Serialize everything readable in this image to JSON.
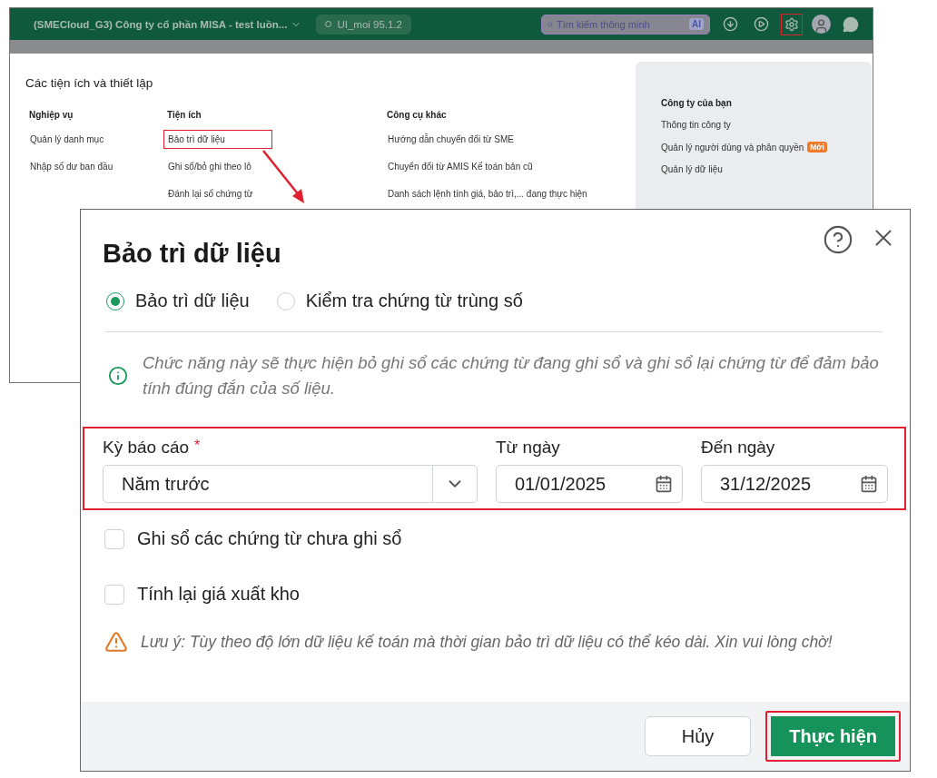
{
  "app_bar": {
    "company": "(SMECloud_G3) Công ty cổ phần MISA - test luồn...",
    "version": "UI_moi 95.1.2",
    "search": {
      "placeholder": "Tìm kiếm thông minh",
      "badge": "AI"
    },
    "settings_highlighted": true
  },
  "settings_menu": {
    "title": "Các tiện ích và thiết lập",
    "columns": [
      {
        "heading": "Nghiệp vụ",
        "items": [
          {
            "label": "Quản lý danh mục",
            "highlighted": false
          },
          {
            "label": "Nhập số dư ban đầu",
            "highlighted": false
          }
        ]
      },
      {
        "heading": "Tiện ích",
        "items": [
          {
            "label": "Bảo trì dữ liệu",
            "highlighted": true
          },
          {
            "label": "Ghi sổ/bỏ ghi theo lô",
            "highlighted": false
          },
          {
            "label": "Đánh lại số chứng từ",
            "highlighted": false
          }
        ]
      },
      {
        "heading": "Công cụ khác",
        "items": [
          {
            "label": "Hướng dẫn chuyển đổi từ SME",
            "highlighted": false
          },
          {
            "label": "Chuyển đổi từ AMIS Kế toán bản cũ",
            "highlighted": false
          },
          {
            "label": "Danh sách lệnh tính giá, bảo trì,... đang thực hiện",
            "highlighted": false
          }
        ]
      }
    ],
    "side_panel": {
      "heading": "Công ty của bạn",
      "items": [
        {
          "label": "Thông tin công ty"
        },
        {
          "label": "Quản lý người dùng và phân quyền",
          "badge": "Mới"
        },
        {
          "label": "Quản lý dữ liệu"
        }
      ]
    }
  },
  "dialog": {
    "title": "Bảo trì dữ liệu",
    "modes": [
      {
        "label": "Bảo trì dữ liệu",
        "selected": true
      },
      {
        "label": "Kiểm tra chứng từ trùng số",
        "selected": false
      }
    ],
    "info": "Chức năng này sẽ thực hiện bỏ ghi sổ các chứng từ đang ghi sổ và ghi sổ lại chứng từ để đảm bảo tính đúng đắn của số liệu.",
    "form_highlighted": true,
    "period": {
      "label": "Kỳ báo cáo",
      "required_mark": "*",
      "value": "Năm trước"
    },
    "from": {
      "label": "Từ ngày",
      "value": "01/01/2025"
    },
    "to": {
      "label": "Đến ngày",
      "value": "31/12/2025"
    },
    "options": [
      {
        "label": "Ghi sổ các chứng từ chưa ghi sổ",
        "checked": false
      },
      {
        "label": "Tính lại giá xuất kho",
        "checked": false
      }
    ],
    "warning": "Lưu ý: Tùy theo độ lớn dữ liệu kế toán mà thời gian bảo trì dữ liệu có thể kéo dài. Xin vui lòng chờ!",
    "buttons": [
      {
        "label": "Hủy",
        "kind": "secondary",
        "highlighted": false
      },
      {
        "label": "Thực hiện",
        "kind": "primary",
        "highlighted": true
      }
    ]
  }
}
